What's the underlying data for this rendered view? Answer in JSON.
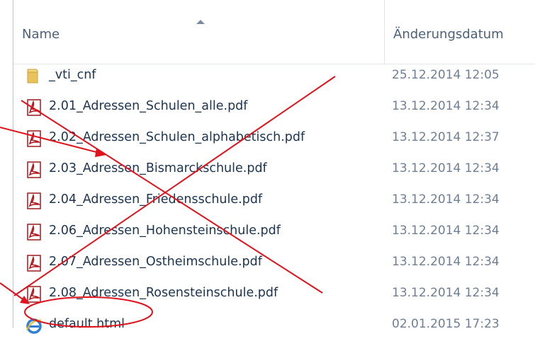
{
  "columns": {
    "name": "Name",
    "modified": "Änderungsdatum"
  },
  "files": [
    {
      "name": "_vti_cnf",
      "modified": "25.12.2014 12:05",
      "icon": "folder-icon"
    },
    {
      "name": "2.01_Adressen_Schulen_alle.pdf",
      "modified": "13.12.2014 12:34",
      "icon": "pdf-icon"
    },
    {
      "name": "2.02_Adressen_Schulen_alphabetisch.pdf",
      "modified": "13.12.2014 12:37",
      "icon": "pdf-icon"
    },
    {
      "name": "2.03_Adressen_Bismarckschule.pdf",
      "modified": "13.12.2014 12:34",
      "icon": "pdf-icon"
    },
    {
      "name": "2.04_Adressen_Friedensschule.pdf",
      "modified": "13.12.2014 12:34",
      "icon": "pdf-icon"
    },
    {
      "name": "2.06_Adressen_Hohensteinschule.pdf",
      "modified": "13.12.2014 12:34",
      "icon": "pdf-icon"
    },
    {
      "name": "2.07_Adressen_Ostheimschule.pdf",
      "modified": "13.12.2014 12:34",
      "icon": "pdf-icon"
    },
    {
      "name": "2.08_Adressen_Rosensteinschule.pdf",
      "modified": "13.12.2014 12:34",
      "icon": "pdf-icon"
    },
    {
      "name": "default.html",
      "modified": "02.01.2015 17:23",
      "icon": "ie-html-icon"
    }
  ],
  "colors": {
    "annotation": "#e0121b",
    "pdf": "#b3151b",
    "folder": "#e8c35a"
  }
}
